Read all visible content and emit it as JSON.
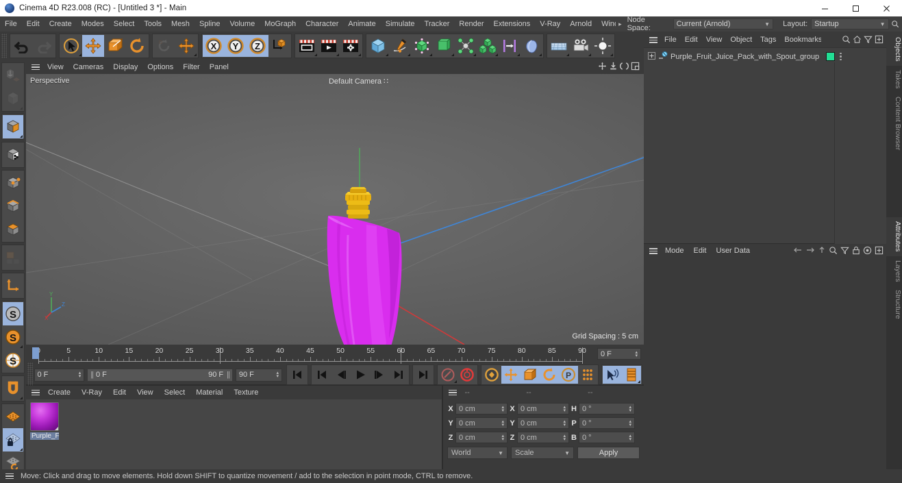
{
  "window": {
    "title": "Cinema 4D R23.008 (RC) - [Untitled 3 *] - Main",
    "app_icon": "c4d-logo-icon",
    "minimize": "─",
    "maximize": "☐",
    "close": "✕"
  },
  "menubar": {
    "items": [
      "File",
      "Edit",
      "Create",
      "Modes",
      "Select",
      "Tools",
      "Mesh",
      "Spline",
      "Volume",
      "MoGraph",
      "Character",
      "Animate",
      "Simulate",
      "Tracker",
      "Render",
      "Extensions",
      "V-Ray",
      "Arnold",
      "Wind"
    ],
    "overflow_arrow": "▸",
    "node_space_label": "Node Space:",
    "node_space_value": "Current (Arnold)",
    "layout_label": "Layout:",
    "layout_value": "Startup",
    "search_icon": "search-icon"
  },
  "toolbar": {
    "groups": [
      {
        "name": "undo-redo",
        "buttons": [
          {
            "icon": "undo-icon",
            "label": "Undo",
            "state": "normal"
          },
          {
            "icon": "redo-icon",
            "label": "Redo",
            "state": "disabled"
          }
        ]
      },
      {
        "name": "transform-tools",
        "buttons": [
          {
            "icon": "live-selection-icon",
            "label": "Live Selection",
            "state": "normal",
            "corner": true
          },
          {
            "icon": "move-icon",
            "label": "Move",
            "state": "active"
          },
          {
            "icon": "scale-icon",
            "label": "Scale",
            "state": "normal"
          },
          {
            "icon": "rotate-icon",
            "label": "Rotate",
            "state": "normal"
          }
        ]
      },
      {
        "name": "dynamic-place",
        "buttons": [
          {
            "icon": "dynamic-place-icon",
            "label": "Dynamic Place",
            "state": "disabled"
          },
          {
            "icon": "move-axis-icon",
            "label": "Move Axis",
            "state": "normal",
            "corner": true
          }
        ]
      },
      {
        "name": "axis-locks",
        "buttons": [
          {
            "icon": "x-axis-icon",
            "label": "X Axis",
            "state": "active"
          },
          {
            "icon": "y-axis-icon",
            "label": "Y Axis",
            "state": "active"
          },
          {
            "icon": "z-axis-icon",
            "label": "Z Axis",
            "state": "active"
          },
          {
            "icon": "world-object-axis-icon",
            "label": "World / Object Coordinate System",
            "state": "normal"
          }
        ]
      },
      {
        "name": "render-group",
        "buttons": [
          {
            "icon": "render-view-icon",
            "label": "Render View",
            "state": "normal",
            "corner": true
          },
          {
            "icon": "render-queue-icon",
            "label": "Render to Picture Viewer",
            "state": "normal",
            "corner": true
          },
          {
            "icon": "render-settings-icon",
            "label": "Edit Render Settings",
            "state": "normal",
            "corner": true
          }
        ]
      },
      {
        "name": "objects-group",
        "buttons": [
          {
            "icon": "cube-primitive-icon",
            "label": "Add Cube Object",
            "state": "normal",
            "corner": true
          },
          {
            "icon": "spline-pen-icon",
            "label": "Spline Pen",
            "state": "normal",
            "corner": true
          },
          {
            "icon": "subdivision-surface-icon",
            "label": "Subdivision Surface",
            "state": "normal",
            "corner": true
          },
          {
            "icon": "extrude-icon",
            "label": "Extrude",
            "state": "normal",
            "corner": true
          },
          {
            "icon": "mograph-cloner-icon",
            "label": "MoGraph Cloner",
            "state": "normal",
            "corner": true
          },
          {
            "icon": "array-icon",
            "label": "Array",
            "state": "normal",
            "corner": true
          },
          {
            "icon": "field-icon",
            "label": "Linear Field",
            "state": "normal",
            "corner": true
          },
          {
            "icon": "deformer-icon",
            "label": "Bend Deformer",
            "state": "normal",
            "corner": true
          }
        ]
      },
      {
        "name": "scene-group",
        "buttons": [
          {
            "icon": "floor-icon",
            "label": "Floor",
            "state": "normal",
            "corner": true
          },
          {
            "icon": "camera-icon",
            "label": "Camera",
            "state": "normal",
            "corner": true
          },
          {
            "icon": "light-icon",
            "label": "Light",
            "state": "normal",
            "corner": true
          }
        ]
      }
    ]
  },
  "lefttoolbar": {
    "groups": [
      {
        "buttons": [
          {
            "icon": "make-editable-icon",
            "label": "Make Editable",
            "state": "disabled"
          },
          {
            "icon": "model-mode-icon",
            "label": "Model Mode",
            "state": "disabled"
          }
        ]
      },
      {
        "buttons": [
          {
            "icon": "object-mode-icon",
            "label": "Object Mode",
            "state": "active",
            "corner": true
          }
        ]
      },
      {
        "buttons": [
          {
            "icon": "texture-mode-icon",
            "label": "Texture Mode",
            "state": "normal"
          }
        ]
      },
      {
        "buttons": [
          {
            "icon": "points-mode-icon",
            "label": "Points Mode",
            "state": "normal"
          },
          {
            "icon": "edges-mode-icon",
            "label": "Edges Mode",
            "state": "normal"
          },
          {
            "icon": "polygons-mode-icon",
            "label": "Polygons Mode",
            "state": "normal"
          }
        ]
      },
      {
        "buttons": [
          {
            "icon": "viewport-solo-icon",
            "label": "Viewport Solo Single",
            "state": "disabled"
          }
        ]
      },
      {
        "buttons": [
          {
            "icon": "enable-axis-icon",
            "label": "Enable Axis Modification",
            "state": "normal"
          }
        ]
      },
      {
        "buttons": [
          {
            "icon": "world-axis-icon",
            "label": "Object Axis",
            "state": "active"
          },
          {
            "icon": "object-axis-icon",
            "label": "World Axis",
            "state": "normal",
            "corner": true
          },
          {
            "icon": "camera-axis-icon",
            "label": "Camera Axis",
            "state": "normal"
          }
        ]
      },
      {
        "buttons": [
          {
            "icon": "snap-icon",
            "label": "Enable Snapping",
            "state": "normal",
            "corner": true
          }
        ]
      },
      {
        "buttons": [
          {
            "icon": "workplane-icon",
            "label": "Workplane",
            "state": "normal"
          },
          {
            "icon": "lock-workplane-icon",
            "label": "Lock Workplane",
            "state": "active",
            "corner": true
          },
          {
            "icon": "planar-workplane-icon",
            "label": "Planar Workplane",
            "state": "normal"
          }
        ]
      }
    ]
  },
  "viewport": {
    "menu": [
      "View",
      "Cameras",
      "Display",
      "Options",
      "Filter",
      "Panel"
    ],
    "hamburger_icon": "hamburger-icon",
    "right_icons": [
      "pan-icon",
      "zoom-icon",
      "rotate-view-icon",
      "maximize-view-icon"
    ],
    "projection_label": "Perspective",
    "camera_label": "Default Camera",
    "grid_spacing": "Grid Spacing : 5 cm",
    "axis_gizmo": {
      "x": "X",
      "y": "Y",
      "z": "Z"
    },
    "object": {
      "name": "Purple Fruit Juice Pack with Spout",
      "body_color": "#d92dee",
      "cap_color": "#e8b010"
    }
  },
  "timeline": {
    "ticks": [
      0,
      5,
      10,
      15,
      20,
      25,
      30,
      35,
      40,
      45,
      50,
      55,
      60,
      65,
      70,
      75,
      80,
      85,
      90
    ],
    "start": 0,
    "end": 90,
    "current_frame_field": "0 F",
    "playhead_frame": 0
  },
  "playbar": {
    "current_frame": "0 F",
    "range_start": "0 F",
    "range_end": "90 F",
    "max_frame": "90 F",
    "buttons": [
      {
        "icon": "go-to-start-icon",
        "label": "Go to Start of Animation",
        "state": "normal"
      },
      {
        "icon": "go-to-prev-key-icon",
        "label": "Go to Previous Key",
        "state": "normal"
      },
      {
        "icon": "step-back-icon",
        "label": "Go to Previous Frame",
        "state": "normal"
      },
      {
        "icon": "play-icon",
        "label": "Play Forwards",
        "state": "normal"
      },
      {
        "icon": "step-forward-icon",
        "label": "Go to Next Frame",
        "state": "normal"
      },
      {
        "icon": "go-to-next-key-icon",
        "label": "Go to Next Key",
        "state": "normal"
      },
      {
        "icon": "go-to-end-icon",
        "label": "Go to End of Animation",
        "state": "normal"
      }
    ],
    "record_group": [
      {
        "icon": "autokey-icon",
        "label": "Autokeying",
        "state": "disabled",
        "corner": true
      },
      {
        "icon": "record-key-icon",
        "label": "Record Active Objects",
        "state": "normal"
      }
    ],
    "key_group": [
      {
        "icon": "keyframe-selection-icon",
        "label": "Keyframe Selection",
        "state": "normal"
      },
      {
        "icon": "position-key-icon",
        "label": "Position",
        "state": "active"
      },
      {
        "icon": "scale-key-icon",
        "label": "Scale",
        "state": "active"
      },
      {
        "icon": "rotation-key-icon",
        "label": "Rotation",
        "state": "active"
      },
      {
        "icon": "pla-key-icon",
        "label": "Point Level Animation",
        "state": "active"
      },
      {
        "icon": "parameter-key-icon",
        "label": "Parameter",
        "state": "normal"
      }
    ],
    "sound_group": [
      {
        "icon": "sound-icon",
        "label": "Play Sound",
        "state": "active"
      },
      {
        "icon": "timeline-icon",
        "label": "Timeline",
        "state": "normal",
        "corner": true
      }
    ]
  },
  "material_manager": {
    "hamburger_icon": "hamburger-icon",
    "menu": [
      "Create",
      "V-Ray",
      "Edit",
      "View",
      "Select",
      "Material",
      "Texture"
    ],
    "materials": [
      {
        "name": "Purple_F",
        "color": "#c83cdd",
        "selected": true
      }
    ]
  },
  "coordinates": {
    "hamburger_icon": "hamburger-icon",
    "headers": [
      "--",
      "--",
      "--"
    ],
    "rows": [
      {
        "pos_label": "X",
        "pos_value": "0 cm",
        "size_label": "X",
        "size_value": "0 cm",
        "rot_label": "H",
        "rot_value": "0 °"
      },
      {
        "pos_label": "Y",
        "pos_value": "0 cm",
        "size_label": "Y",
        "size_value": "0 cm",
        "rot_label": "P",
        "rot_value": "0 °"
      },
      {
        "pos_label": "Z",
        "pos_value": "0 cm",
        "size_label": "Z",
        "size_value": "0 cm",
        "rot_label": "B",
        "rot_value": "0 °"
      }
    ],
    "system": "World",
    "mode": "Scale",
    "apply": "Apply"
  },
  "object_manager": {
    "hamburger_icon": "hamburger-icon",
    "menu": [
      "File",
      "Edit",
      "View",
      "Object",
      "Tags",
      "Bookmarks"
    ],
    "icons": [
      "search-icon",
      "home-icon",
      "filter-icon",
      "add-icon"
    ],
    "items": [
      {
        "expander": "plus-box-icon",
        "icon": "null-object-icon",
        "name": "Purple_Fruit_Juice_Pack_with_Spout_group",
        "tag_color": "#22dd94"
      }
    ]
  },
  "attribute_manager": {
    "hamburger_icon": "hamburger-icon",
    "menu": [
      "Mode",
      "Edit",
      "User Data"
    ],
    "icons": [
      "back-arrow-icon",
      "forward-arrow-icon",
      "up-arrow-icon",
      "search-icon",
      "filter-icon",
      "lock-icon",
      "record-icon",
      "add-icon"
    ]
  },
  "vertical_tabs": [
    {
      "label": "Objects",
      "active": true
    },
    {
      "label": "Takes",
      "active": false
    },
    {
      "label": "Content Browser",
      "active": false
    },
    {
      "label": "Attributes",
      "active": true
    },
    {
      "label": "Layers",
      "active": false
    },
    {
      "label": "Structure",
      "active": false
    }
  ],
  "statusbar": {
    "hamburger_icon": "hamburger-icon",
    "text": "Move: Click and drag to move elements. Hold down SHIFT to quantize movement / add to the selection in point mode, CTRL to remove."
  }
}
